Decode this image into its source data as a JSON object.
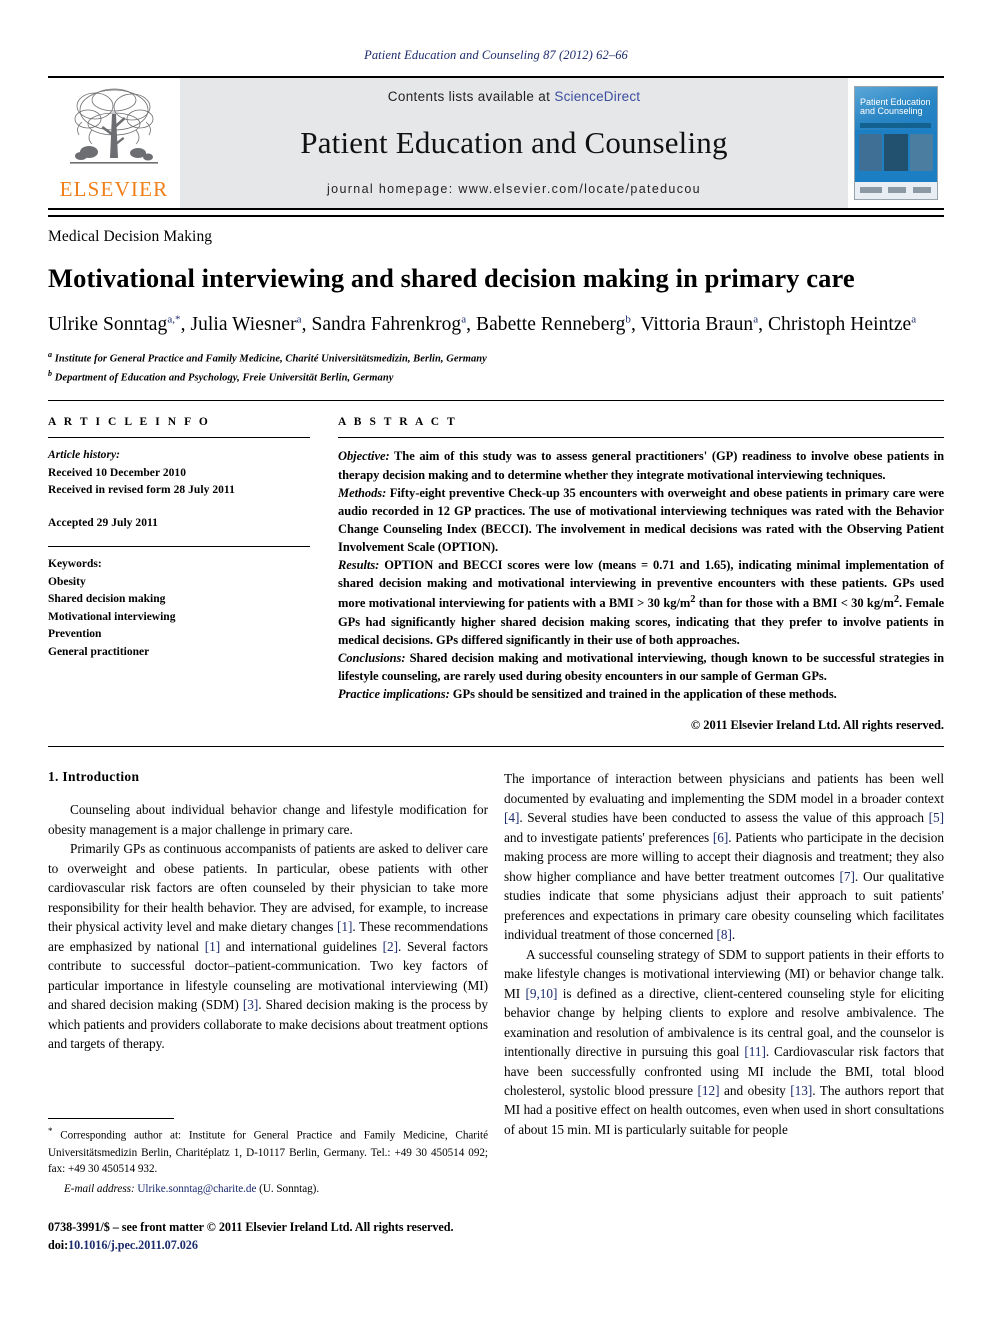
{
  "running_head": "Patient Education and Counseling 87 (2012) 62–66",
  "masthead": {
    "contents_prefix": "Contents lists available at ",
    "sciencedirect": "ScienceDirect",
    "journal_name": "Patient Education and Counseling",
    "homepage": "journal homepage: www.elsevier.com/locate/pateducou",
    "publisher_wordmark": "ELSEVIER",
    "cover_title_line1": "Patient Education",
    "cover_title_line2": "and Counseling",
    "accent_orange": "#f07f1a",
    "link_blue": "#3b4ea0",
    "cite_blue": "#1b2a6b"
  },
  "article": {
    "section_label": "Medical Decision Making",
    "title": "Motivational interviewing and shared decision making in primary care",
    "authors_html": "Ulrike Sonntag a,*, Julia Wiesner a, Sandra Fahrenkrog a, Babette Renneberg b, Vittoria Braun a, Christoph Heintze a",
    "affiliation_a": "Institute for General Practice and Family Medicine, Charité Universitätsmedizin, Berlin, Germany",
    "affiliation_b": "Department of Education and Psychology, Freie Universität Berlin, Germany"
  },
  "article_info": {
    "heading": "A R T I C L E  I N F O",
    "history_label": "Article history:",
    "received": "Received 10 December 2010",
    "revised": "Received in revised form 28 July 2011",
    "accepted": "Accepted 29 July 2011",
    "keywords_label": "Keywords:",
    "keywords": [
      "Obesity",
      "Shared decision making",
      "Motivational interviewing",
      "Prevention",
      "General practitioner"
    ]
  },
  "abstract": {
    "heading": "A B S T R A C T",
    "objective_label": "Objective:",
    "objective_text": " The aim of this study was to assess general practitioners' (GP) readiness to involve obese patients in therapy decision making and to determine whether they integrate motivational interviewing techniques.",
    "methods_label": "Methods:",
    "methods_text": " Fifty-eight preventive Check-up 35 encounters with overweight and obese patients in primary care were audio recorded in 12 GP practices. The use of motivational interviewing techniques was rated with the Behavior Change Counseling Index (BECCI). The involvement in medical decisions was rated with the Observing Patient Involvement Scale (OPTION).",
    "results_label": "Results:",
    "results_text_1": " OPTION and BECCI scores were low (means = 0.71 and 1.65), indicating minimal implementation of shared decision making and motivational interviewing in preventive encounters with these patients. GPs used more motivational interviewing for patients with a BMI > 30 kg/m",
    "results_text_2": " than for those with a BMI < 30 kg/m",
    "results_text_3": ". Female GPs had significantly higher shared decision making scores, indicating that they prefer to involve patients in medical decisions. GPs differed significantly in their use of both approaches.",
    "superscript_2": "2",
    "conclusions_label": "Conclusions:",
    "conclusions_text": " Shared decision making and motivational interviewing, though known to be successful strategies in lifestyle counseling, are rarely used during obesity encounters in our sample of German GPs.",
    "implications_label": "Practice implications:",
    "implications_text": " GPs should be sensitized and trained in the application of these methods.",
    "copyright": "© 2011 Elsevier Ireland Ltd. All rights reserved."
  },
  "introduction": {
    "heading": "1. Introduction",
    "left_para_1": "Counseling about individual behavior change and lifestyle modification for obesity management is a major challenge in primary care.",
    "left_para_2_a": "Primarily GPs as continuous accompanists of patients are asked to deliver care to overweight and obese patients. In particular, obese patients with other cardiovascular risk factors are often counseled by their physician to take more responsibility for their health behavior. They are advised, for example, to increase their physical activity level and make dietary changes ",
    "left_para_2_c1": "[1]",
    "left_para_2_b": ". These recommendations are emphasized by national ",
    "left_para_2_c2": "[1]",
    "left_para_2_d": " and international guidelines ",
    "left_para_2_c3": "[2]",
    "left_para_2_e": ". Several factors contribute to successful doctor–patient-communication. Two key factors of particular importance in lifestyle counseling are motivational interviewing (MI) and shared decision making (SDM) ",
    "left_para_2_c4": "[3]",
    "left_para_2_f": ". Shared decision making is the process by which patients and providers collaborate to make decisions about treatment options and targets of therapy.",
    "right_para_1_a": "The importance of interaction between physicians and patients has been well documented by evaluating and implementing the SDM model in a broader context ",
    "right_c4": "[4]",
    "right_para_1_b": ". Several studies have been conducted to assess the value of this approach ",
    "right_c5": "[5]",
    "right_para_1_c": " and to investigate patients' preferences ",
    "right_c6": "[6]",
    "right_para_1_d": ". Patients who participate in the decision making process are more willing to accept their diagnosis and treatment; they also show higher compliance and have better treatment outcomes ",
    "right_c7": "[7]",
    "right_para_1_e": ". Our qualitative studies indicate that some physicians adjust their approach to suit patients' preferences and expectations in primary care obesity counseling which facilitates individual treatment of those concerned ",
    "right_c8": "[8]",
    "right_para_1_f": ".",
    "right_para_2_a": "A successful counseling strategy of SDM to support patients in their efforts to make lifestyle changes is motivational interviewing (MI) or behavior change talk. MI ",
    "right_c910": "[9,10]",
    "right_para_2_b": " is defined as a directive, client-centered counseling style for eliciting behavior change by helping clients to explore and resolve ambivalence. The examination and resolution of ambivalence is its central goal, and the counselor is intentionally directive in pursuing this goal ",
    "right_c11": "[11]",
    "right_para_2_c": ". Cardiovascular risk factors that have been successfully confronted using MI include the BMI, total blood cholesterol, systolic blood pressure ",
    "right_c12": "[12]",
    "right_para_2_d": " and obesity ",
    "right_c13": "[13]",
    "right_para_2_e": ". The authors report that MI had a positive effect on health outcomes, even when used in short consultations of about 15 min. MI is particularly suitable for people"
  },
  "footnote": {
    "star": "*",
    "corresponding": " Corresponding author at: Institute for General Practice and Family Medicine, Charité Universitätsmedizin Berlin, Charitéplatz 1, D-10117 Berlin, Germany. Tel.: +49 30 450514 092; fax: +49 30 450514 932.",
    "email_label": "E-mail address:",
    "email_address": " Ulrike.sonntag@charite.de",
    "email_suffix": " (U. Sonntag)."
  },
  "imprint": {
    "line1": "0738-3991/$ – see front matter © 2011 Elsevier Ireland Ltd. All rights reserved.",
    "doi_prefix": "doi:",
    "doi_value": "10.1016/j.pec.2011.07.026"
  }
}
